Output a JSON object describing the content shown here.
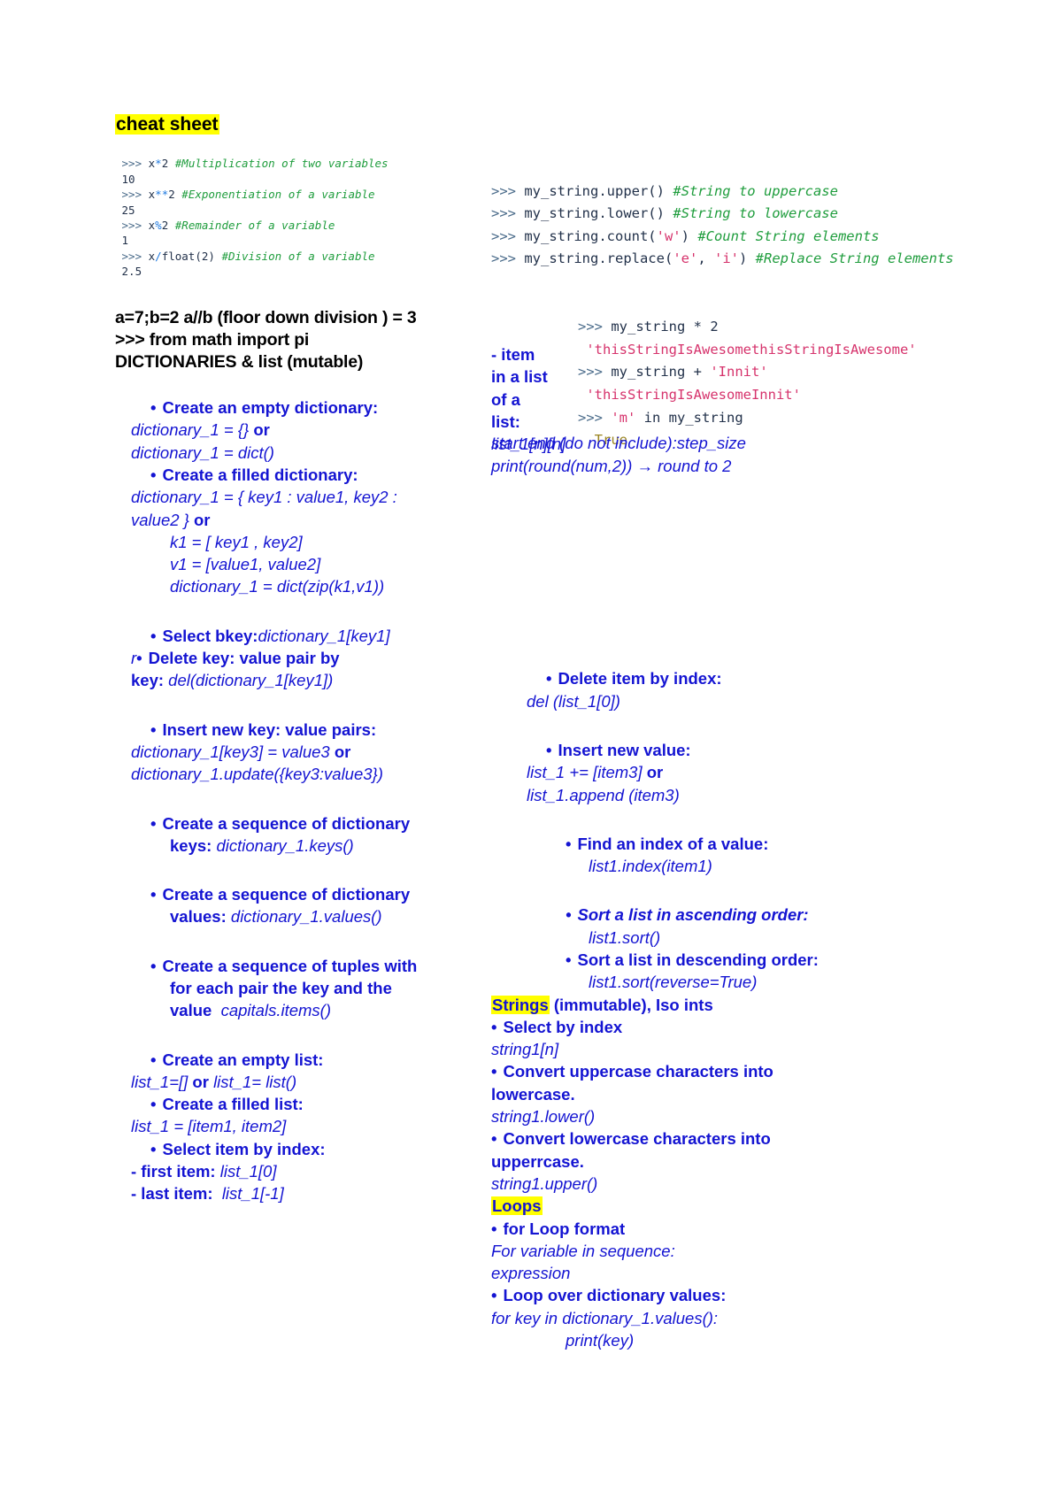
{
  "document": {
    "title": "cheat sheet"
  },
  "left_column": {
    "heading": "cheat sheet",
    "repl_lines": [
      {
        "prompt": ">>>",
        "code_pre": "x",
        "op": "*",
        "code_post": "2",
        "comment": "#Multiplication of two variables"
      },
      {
        "output": "10"
      },
      {
        "prompt": ">>>",
        "code_pre": "x",
        "op": "**",
        "code_post": "2",
        "comment": "#Exponentiation of a variable"
      },
      {
        "output": "25"
      },
      {
        "prompt": ">>>",
        "code_pre": "x",
        "op": "%",
        "code_post": "2",
        "comment": "#Remainder of a variable"
      },
      {
        "output": "1"
      },
      {
        "prompt": ">>>",
        "code_pre": "x",
        "op": "/",
        "code_post": "float(2)",
        "comment": "#Division of a variable"
      },
      {
        "output": "2.5"
      }
    ],
    "black_lines": [
      "a=7;b=2 a//b (floor down division ) = 3",
      ">>> from math import pi",
      "DICTIONARIES & list (mutable)"
    ],
    "entries": [
      {
        "bullet": "Create an empty dictionary:"
      },
      {
        "code": "dictionary_1 = {}",
        "suffix_bold": "or"
      },
      {
        "code": "dictionary_1 = dict()"
      },
      {
        "bullet": "Create a filled dictionary:"
      },
      {
        "code": "dictionary_1 = { key1 : value1, key2 :"
      },
      {
        "code": "value2 }",
        "suffix_bold": "or"
      },
      {
        "code": "k1 = [ key1 , key2]"
      },
      {
        "code": "v1 = [value1, value2]"
      },
      {
        "code": "dictionary_1 = dict(zip(k1,v1))"
      },
      {
        "bullet": "Select bkey:",
        "inline_code": "dictionary_1[key1]"
      },
      {
        "prefix_ital": "r",
        "bullet": "Delete key: value pair by"
      },
      {
        "bullet_label": "key:",
        "inline_code": "del(dictionary_1[key1])"
      },
      {
        "bullet": "Insert new key: value pairs:"
      },
      {
        "code": "dictionary_1[key3] = value3",
        "suffix_bold": "or"
      },
      {
        "code": "dictionary_1.update({key3:value3})"
      },
      {
        "bullet": "Create a sequence of dictionary"
      },
      {
        "bullet_label": "keys:",
        "inline_code": "dictionary_1.keys()"
      },
      {
        "bullet": "Create a sequence of dictionary"
      },
      {
        "bullet_label": "values:",
        "inline_code": "dictionary_1.values()"
      },
      {
        "bullet": "Create a sequence of tuples with"
      },
      {
        "cont": "for each pair the key and the"
      },
      {
        "bullet_label": "value",
        "inline_code": "capitals.items()"
      },
      {
        "bullet": "Create an empty list:"
      },
      {
        "code": "list_1=[]",
        "suffix_bold": "or",
        "code2": "list_1= list()"
      },
      {
        "bullet": "Create a filled list:"
      },
      {
        "code": "list_1 = [item1, item2]"
      },
      {
        "bullet": "Select item by index:"
      },
      {
        "bullet_label": "- first item:",
        "inline_code": "list_1[0]"
      },
      {
        "bullet_label": "- last item:",
        "inline_code": "list_1[-1]"
      }
    ]
  },
  "right_column": {
    "repl_lines": [
      {
        "prompt": ">>>",
        "code": "my_string.upper()",
        "comment": "#String to uppercase"
      },
      {
        "prompt": ">>>",
        "code": "my_string.lower()",
        "comment": "#String to lowercase"
      },
      {
        "prompt": ">>>",
        "code_a": "my_string.count(",
        "str": "'w'",
        "code_b": ")",
        "comment": "#Count String elements"
      },
      {
        "prompt": ">>>",
        "code_a": "my_string.replace(",
        "str": "'e'",
        "mid": ", ",
        "str2": "'i'",
        "code_b": ")",
        "comment": "#Replace String elements"
      }
    ],
    "repl_indented": [
      {
        "prompt": ">>>",
        "code": "my_string * 2"
      },
      {
        "str_out": "'thisStringIsAwesomethisStringIsAwesome'"
      },
      {
        "prompt": ">>>",
        "code_a": "my_string + ",
        "str": "'Innit'"
      },
      {
        "str_out": "'thisStringIsAwesomeInnit'"
      },
      {
        "prompt": ">>>",
        "str": "'m'",
        "code_b": " in my_string"
      },
      {
        "bool_out": "True"
      }
    ],
    "item_stack": {
      "l1": "- item",
      "l2": "in a list",
      "l3": "of a",
      "l4_label": "list:",
      "l4_code": "list_1[n][n]"
    },
    "slice_notes": [
      "start:end (do not include):step_size",
      "print(round(num,2)) → round to 2"
    ],
    "entries": [
      {
        "bullet": "Delete item by index:"
      },
      {
        "code": "del (list_1[0])"
      },
      {
        "bullet": "Insert new value:"
      },
      {
        "code": "list_1 += [item3]",
        "suffix_bold": "or"
      },
      {
        "code": "list_1.append (item3)"
      },
      {
        "bullet": "Find an index of a value:"
      },
      {
        "code": "list1.index(item1)"
      },
      {
        "bullet_ital": "Sort a list in ascending order:"
      },
      {
        "code": "list1.sort()"
      },
      {
        "bullet": "Sort a list in descending order:"
      },
      {
        "code": "list1.sort(reverse=True)"
      }
    ],
    "strings_header": {
      "highlight": "Strings",
      "rest": " (immutable), Iso ints"
    },
    "strings_entries": [
      {
        "bullet": "Select by index"
      },
      {
        "code": "string1[n]"
      },
      {
        "bullet": "Convert uppercase characters into"
      },
      {
        "cont_bold": "lowercase."
      },
      {
        "code": "string1.lower()"
      },
      {
        "bullet": "Convert lowercase characters into"
      },
      {
        "cont_bold": "upperrcase."
      },
      {
        "code": "string1.upper()"
      }
    ],
    "loops_header": "Loops",
    "loops_entries": [
      {
        "bullet": "for Loop format"
      },
      {
        "code": "For variable in sequence:"
      },
      {
        "code": "expression"
      },
      {
        "bullet": "Loop over dictionary values:"
      },
      {
        "code": "for key in dictionary_1.values():"
      },
      {
        "code_ind": "print(key)"
      }
    ]
  }
}
